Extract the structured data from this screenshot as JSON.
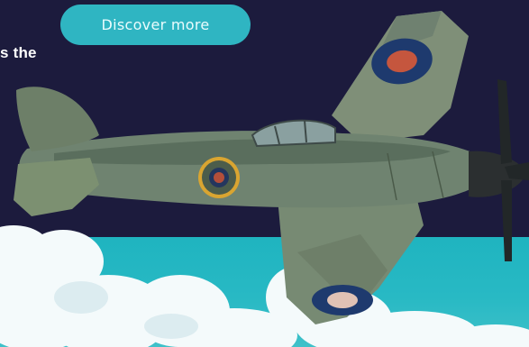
{
  "hero": {
    "headline_fragment": "s the",
    "cta_label": "Discover more",
    "image_subject": "hawker-sea-fury-aircraft-in-flight"
  },
  "colors": {
    "background": "#1c1b3d",
    "sky": "#28b9c4",
    "cta": "#2fb5c2",
    "roundel_blue": "#1e3a6e",
    "roundel_red": "#c5563e"
  }
}
